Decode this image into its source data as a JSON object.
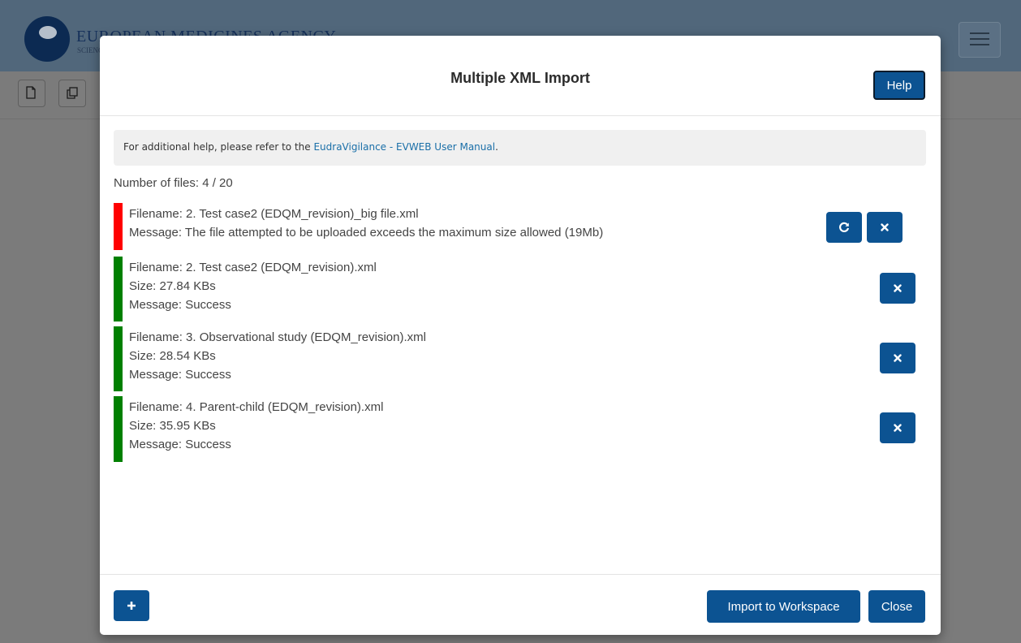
{
  "app": {
    "brand": "EUROPEAN MEDICINES AGENCY",
    "brand_sub": "SCIENCE MEDICINES HEALTH"
  },
  "toolbar": {
    "new_icon": "new-document-icon",
    "copy_icon": "copy-icon"
  },
  "modal": {
    "title": "Multiple XML Import",
    "help_label": "Help",
    "info": {
      "prefix": "For additional help, please refer to the ",
      "link": "EudraVigilance - EVWEB User Manual",
      "suffix": "."
    },
    "file_count": "Number of files: 4 / 20",
    "files": [
      {
        "status": "error",
        "status_color": "#ff0000",
        "filename": "Filename: 2. Test case2 (EDQM_revision)_big file.xml",
        "message": "Message: The file attempted to be uploaded exceeds the maximum size allowed (19Mb)"
      },
      {
        "status": "success",
        "status_color": "#008000",
        "filename": "Filename: 2. Test case2 (EDQM_revision).xml",
        "size": "Size: 27.84 KBs",
        "message": "Message: Success"
      },
      {
        "status": "success",
        "status_color": "#008000",
        "filename": "Filename: 3. Observational study (EDQM_revision).xml",
        "size": "Size: 28.54 KBs",
        "message": "Message: Success"
      },
      {
        "status": "success",
        "status_color": "#008000",
        "filename": "Filename: 4. Parent-child (EDQM_revision).xml",
        "size": "Size: 35.95 KBs",
        "message": "Message: Success"
      }
    ],
    "footer": {
      "add_icon": "plus-icon",
      "import_label": "Import to Workspace",
      "close_label": "Close"
    }
  },
  "colors": {
    "primary": "#0c5392",
    "error": "#ff0000",
    "success": "#008000",
    "link": "#1a6fa8"
  }
}
